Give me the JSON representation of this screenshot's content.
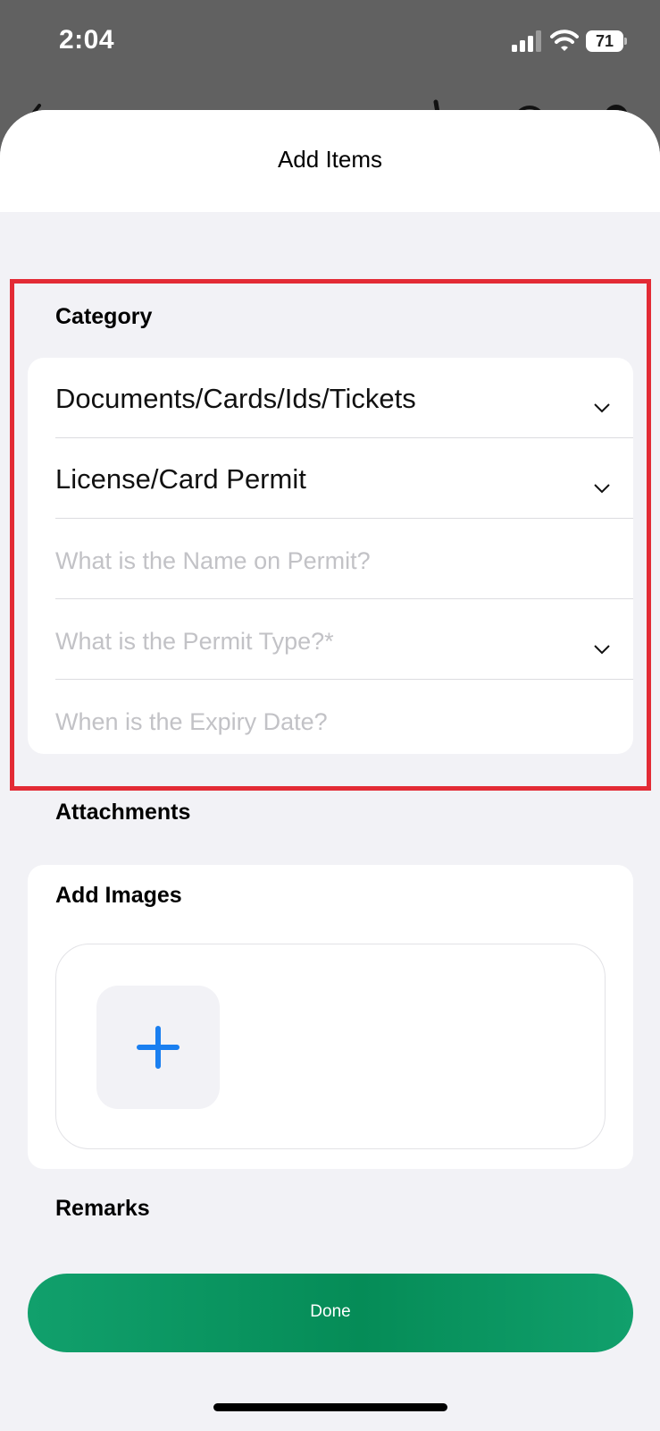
{
  "status_bar": {
    "time": "2:04",
    "battery": "71"
  },
  "sheet": {
    "title": "Add Items"
  },
  "category": {
    "heading": "Category",
    "fields": [
      {
        "value": "Documents/Cards/Ids/Tickets",
        "placeholder": "",
        "has_dropdown": true
      },
      {
        "value": "License/Card Permit",
        "placeholder": "",
        "has_dropdown": true
      },
      {
        "value": "",
        "placeholder": "What is the Name on Permit?",
        "has_dropdown": false
      },
      {
        "value": "",
        "placeholder": "What is the Permit Type?*",
        "has_dropdown": true
      },
      {
        "value": "",
        "placeholder": "When is the Expiry Date?",
        "has_dropdown": false
      }
    ]
  },
  "attachments": {
    "heading": "Attachments",
    "add_images_label": "Add Images"
  },
  "remarks": {
    "heading": "Remarks"
  },
  "done_button": {
    "label": "Done"
  },
  "colors": {
    "accent_green": "#0a9462",
    "plus_blue": "#1a7ff0",
    "highlight_red": "#e32b35"
  },
  "icons": [
    "signal-icon",
    "wifi-icon",
    "battery-icon",
    "chevron-down-icon",
    "plus-icon"
  ]
}
